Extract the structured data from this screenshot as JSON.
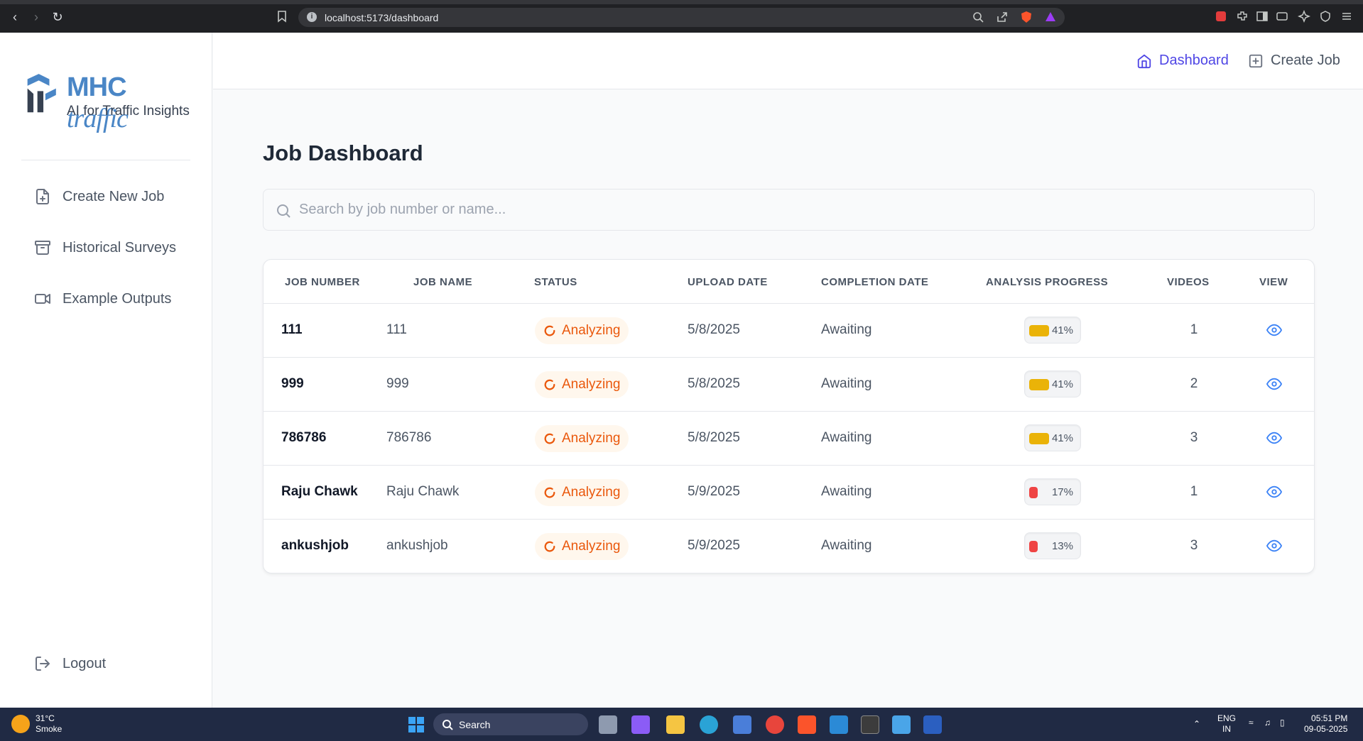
{
  "browser": {
    "url": "localhost:5173/dashboard"
  },
  "sidebar": {
    "logo_title_prefix": "MHC ",
    "logo_title_suffix": "traffic",
    "logo_subtitle": "AI for Traffic Insights",
    "items": [
      {
        "label": "Create New Job",
        "icon": "file-plus-icon"
      },
      {
        "label": "Historical Surveys",
        "icon": "archive-icon"
      },
      {
        "label": "Example Outputs",
        "icon": "video-icon"
      }
    ],
    "logout_label": "Logout"
  },
  "topnav": {
    "dashboard_label": "Dashboard",
    "create_job_label": "Create Job"
  },
  "page": {
    "title": "Job Dashboard",
    "search_placeholder": "Search by job number or name..."
  },
  "table": {
    "headers": [
      "JOB NUMBER",
      "JOB NAME",
      "STATUS",
      "UPLOAD DATE",
      "COMPLETION DATE",
      "ANALYSIS PROGRESS",
      "VIDEOS",
      "VIEW"
    ],
    "rows": [
      {
        "job_number": "111",
        "job_name": "111",
        "status": "Analyzing",
        "upload_date": "5/8/2025",
        "completion_date": "Awaiting",
        "progress": "41%",
        "progress_value": 41,
        "progress_color": "#eab308",
        "videos": "1"
      },
      {
        "job_number": "999",
        "job_name": "999",
        "status": "Analyzing",
        "upload_date": "5/8/2025",
        "completion_date": "Awaiting",
        "progress": "41%",
        "progress_value": 41,
        "progress_color": "#eab308",
        "videos": "2"
      },
      {
        "job_number": "786786",
        "job_name": "786786",
        "status": "Analyzing",
        "upload_date": "5/8/2025",
        "completion_date": "Awaiting",
        "progress": "41%",
        "progress_value": 41,
        "progress_color": "#eab308",
        "videos": "3"
      },
      {
        "job_number": "Raju Chawk",
        "job_name": "Raju Chawk",
        "status": "Analyzing",
        "upload_date": "5/9/2025",
        "completion_date": "Awaiting",
        "progress": "17%",
        "progress_value": 17,
        "progress_color": "#ef4444",
        "videos": "1"
      },
      {
        "job_number": "ankushjob",
        "job_name": "ankushjob",
        "status": "Analyzing",
        "upload_date": "5/9/2025",
        "completion_date": "Awaiting",
        "progress": "13%",
        "progress_value": 13,
        "progress_color": "#ef4444",
        "videos": "3"
      }
    ]
  },
  "taskbar": {
    "weather_temp": "31°C",
    "weather_desc": "Smoke",
    "search_label": "Search",
    "lang_top": "ENG",
    "lang_bottom": "IN",
    "time": "05:51 PM",
    "date": "09-05-2025"
  },
  "colors": {
    "accent": "#4f46e5",
    "status_orange": "#ea580c",
    "view_blue": "#3b82f6"
  }
}
